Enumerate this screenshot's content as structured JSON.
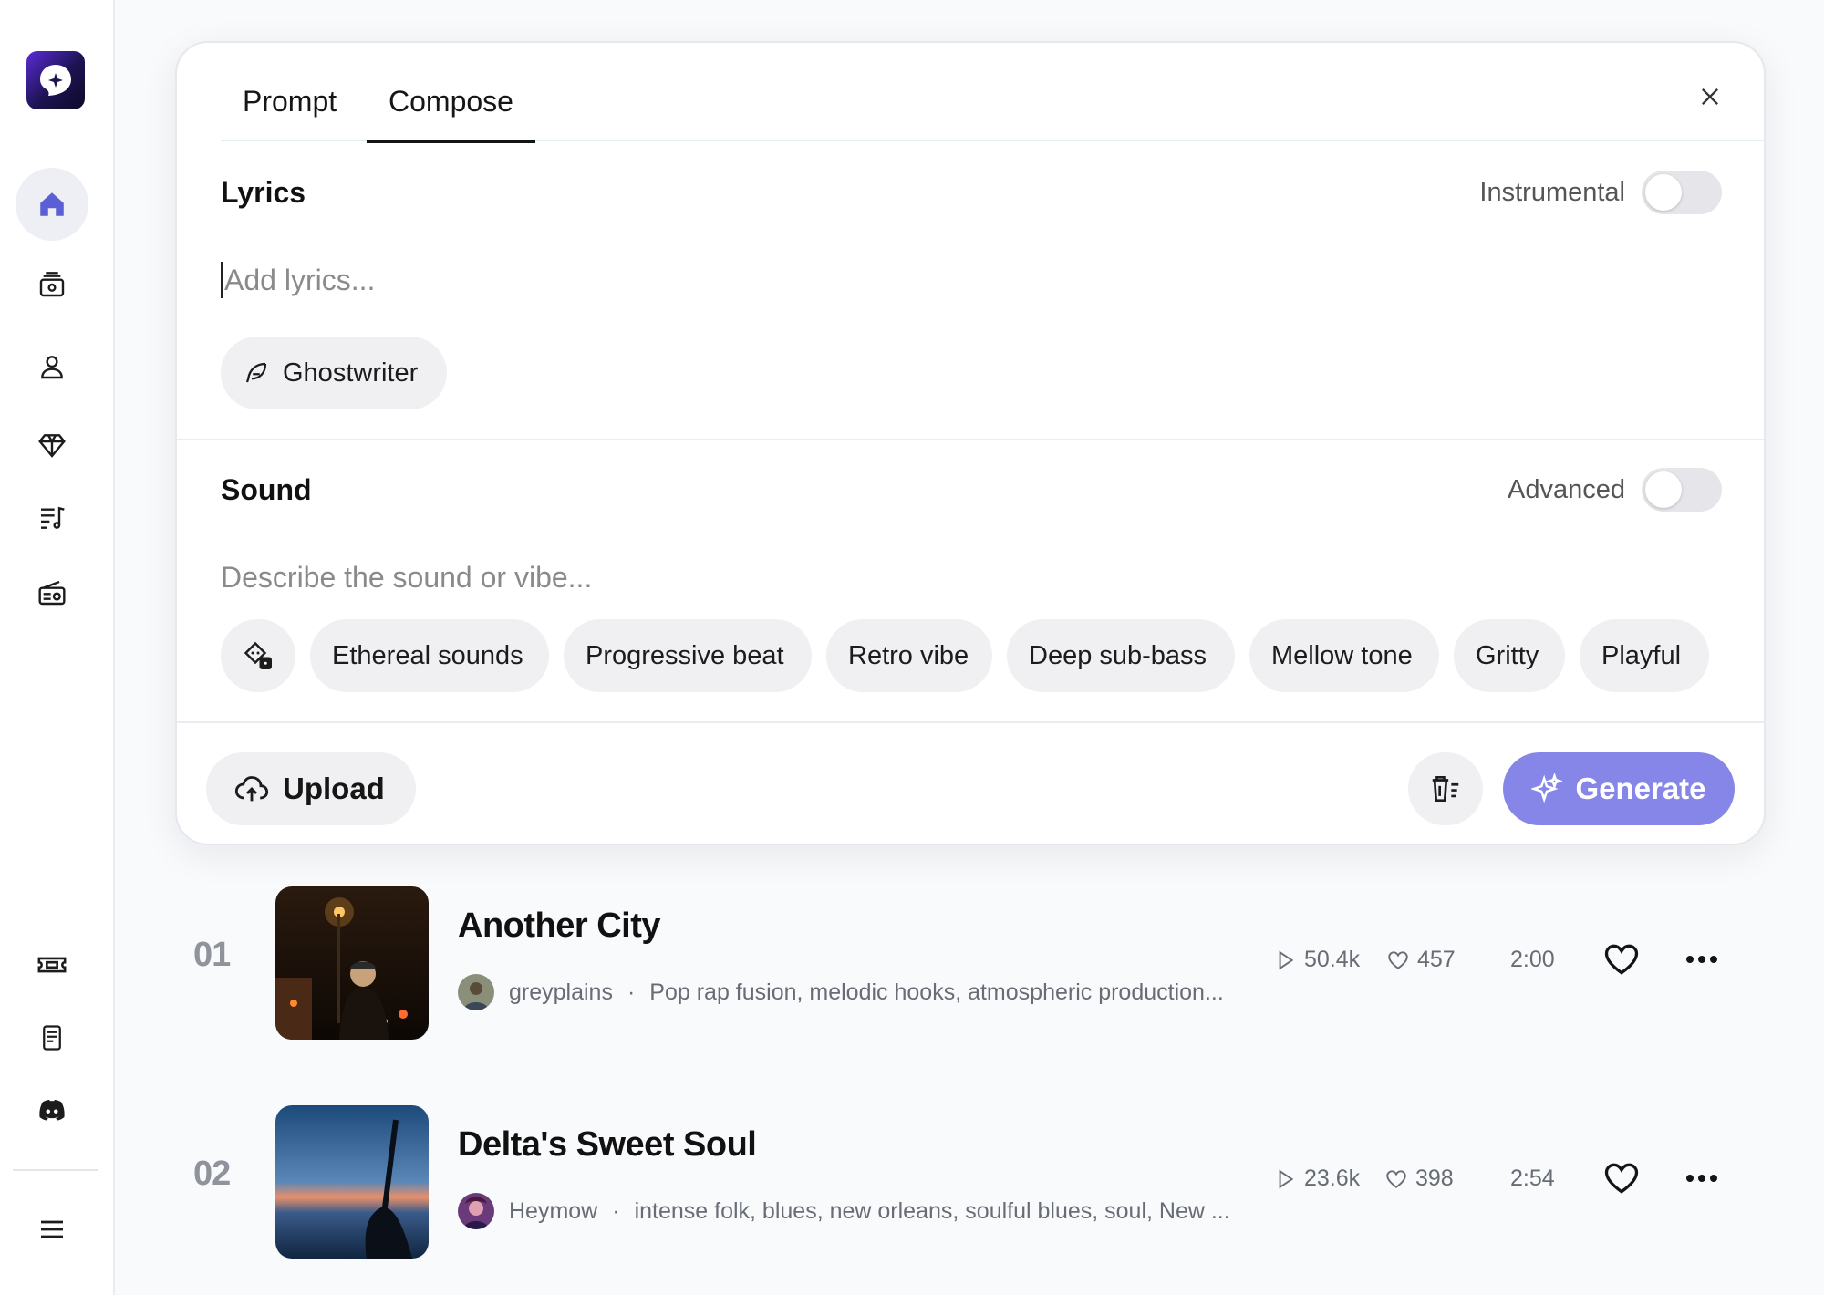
{
  "colors": {
    "accent": "#8586e8",
    "sidebar_active": "#5a5fd6",
    "text_muted": "#686c75"
  },
  "sidebar": {
    "items": [
      {
        "icon": "home-icon"
      },
      {
        "icon": "library-icon"
      },
      {
        "icon": "profile-icon"
      },
      {
        "icon": "diamond-icon"
      },
      {
        "icon": "playlist-icon"
      },
      {
        "icon": "radio-icon"
      },
      {
        "icon": "ticket-icon"
      },
      {
        "icon": "document-icon"
      },
      {
        "icon": "discord-icon"
      },
      {
        "icon": "menu-icon"
      }
    ]
  },
  "composer": {
    "tabs": [
      "Prompt",
      "Compose"
    ],
    "active_tab": "Compose",
    "lyrics": {
      "title": "Lyrics",
      "placeholder": "Add lyrics...",
      "instrumental_label": "Instrumental",
      "instrumental_on": false,
      "ghostwriter_label": "Ghostwriter"
    },
    "sound": {
      "title": "Sound",
      "placeholder": "Describe the sound or vibe...",
      "advanced_label": "Advanced",
      "advanced_on": false,
      "suggestions": [
        "Ethereal sounds",
        "Progressive beat",
        "Retro vibe",
        "Deep sub-bass",
        "Mellow tone",
        "Gritty",
        "Playful"
      ]
    },
    "upload_label": "Upload",
    "generate_label": "Generate"
  },
  "songs": [
    {
      "rank": "01",
      "title": "Another City",
      "artist": "greyplains",
      "separator": "·",
      "tags": "Pop rap fusion, melodic hooks, atmospheric production...",
      "plays": "50.4k",
      "likes": "457",
      "duration": "2:00"
    },
    {
      "rank": "02",
      "title": "Delta's Sweet Soul",
      "artist": "Heymow",
      "separator": "·",
      "tags": "intense folk, blues, new orleans, soulful blues, soul, New ...",
      "plays": "23.6k",
      "likes": "398",
      "duration": "2:54"
    }
  ]
}
